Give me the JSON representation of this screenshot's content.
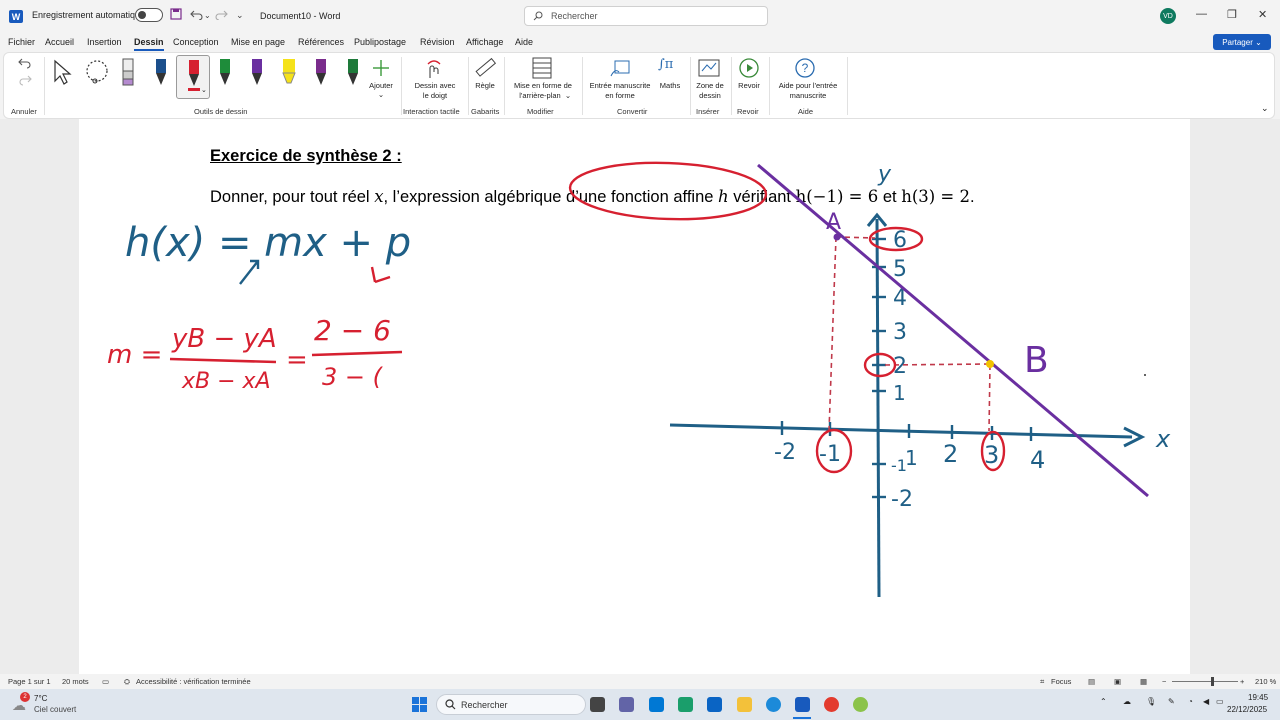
{
  "titlebar": {
    "autosave_label": "Enregistrement automatique",
    "doc_title": "Document10  -  Word",
    "search_placeholder": "Rechercher",
    "user_initials": "VD"
  },
  "menu": [
    "Fichier",
    "Accueil",
    "Insertion",
    "Dessin",
    "Conception",
    "Mise en page",
    "Références",
    "Publipostage",
    "Révision",
    "Affichage",
    "Aide"
  ],
  "active_menu": "Dessin",
  "share_label": "Partager",
  "ribbon": {
    "undo_group": "Annuler",
    "draw_tools_group": "Outils de dessin",
    "add_label": "Ajouter",
    "touch_label_1": "Dessin avec",
    "touch_label_2": "le doigt",
    "touch_group": "Interaction tactile",
    "ruler_label": "Règle",
    "stencils_group": "Gabarits",
    "background_label_1": "Mise en forme de",
    "background_label_2": "l'arrière-plan",
    "modify_group": "Modifier",
    "ink_shape_label_1": "Entrée manuscrite",
    "ink_shape_label_2": "en forme",
    "math_label": "Maths",
    "convert_group": "Convertir",
    "zone_label_1": "Zone de",
    "zone_label_2": "dessin",
    "insert_group": "Insérer",
    "replay_label": "Revoir",
    "replay_group": "Revoir",
    "help_label_1": "Aide pour l'entrée",
    "help_label_2": "manuscrite",
    "help_group": "Aide"
  },
  "document": {
    "exercise_title": "Exercice de synthèse 2 :",
    "exercise_text_1": "Donner, pour tout réel ",
    "var_x": "x",
    "exercise_text_2": ", l’expression algébrique d’une fonction affine ",
    "var_h": "h",
    "exercise_text_3": " vérifiant ",
    "cond1": "h(−1) = 6",
    "and_word": " et ",
    "cond2": "h(3) = 2",
    "period": "."
  },
  "handwriting": {
    "formula": "h(x) = mx + p",
    "slope_lhs": "m =",
    "slope_num": "yB − yA",
    "slope_den": "xB − xA",
    "slope_eq": "=",
    "slope_num_values": "2 − 6",
    "slope_den_values": "3 − (",
    "axis_y": "y",
    "axis_x": "x",
    "point_a": "A",
    "point_b": "B",
    "y_ticks": [
      "6",
      "5",
      "4",
      "3",
      "2",
      "1",
      "-1",
      "-2"
    ],
    "x_ticks": [
      "-2",
      "-1",
      "1",
      "2",
      "3",
      "4"
    ]
  },
  "statusbar": {
    "page": "Page 1 sur 1",
    "words": "20 mots",
    "accessibility": "Accessibilité : vérification terminée",
    "focus": "Focus",
    "zoom": "210 %"
  },
  "taskbar": {
    "weather_temp": "7°C",
    "weather_desc": "Ciel couvert",
    "weather_badge": "2",
    "search": "Rechercher",
    "time": "19:45",
    "date": "22/12/2025"
  },
  "colors": {
    "accent": "#185abd",
    "ink_blue": "#1f5f86",
    "ink_red": "#d62030",
    "ink_purple": "#6a2fa0"
  }
}
